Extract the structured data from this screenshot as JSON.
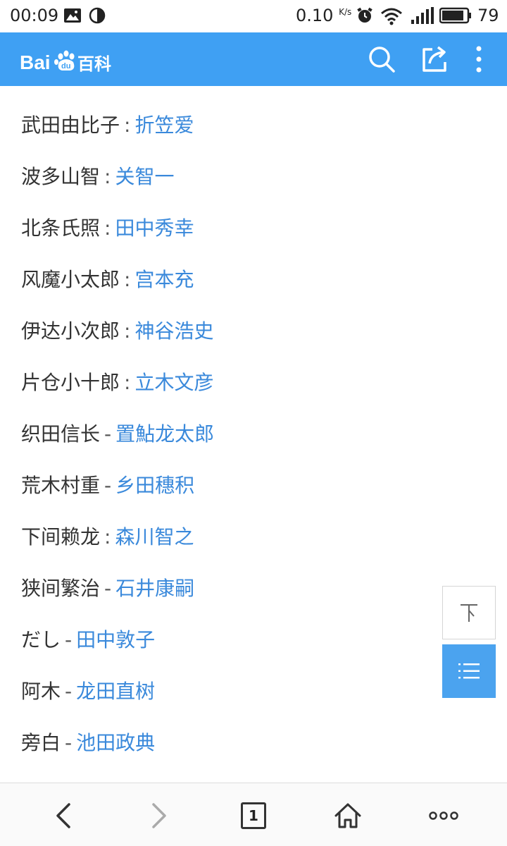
{
  "status_bar": {
    "time": "00:09",
    "net_speed": "0.10",
    "net_unit": "K/s",
    "battery": "79"
  },
  "app_bar": {
    "logo_text": "Bai",
    "logo_paw_text": "du",
    "logo_suffix": "百科"
  },
  "cast": [
    {
      "role": "武田由比子",
      "sep": ":",
      "actor": "折笠爱"
    },
    {
      "role": "波多山智",
      "sep": ":",
      "actor": "关智一"
    },
    {
      "role": "北条氏照",
      "sep": ":",
      "actor": "田中秀幸"
    },
    {
      "role": "风魔小太郎",
      "sep": ":",
      "actor": "宫本充"
    },
    {
      "role": "伊达小次郎",
      "sep": ":",
      "actor": "神谷浩史"
    },
    {
      "role": "片仓小十郎",
      "sep": ":",
      "actor": "立木文彦"
    },
    {
      "role": "织田信长",
      "sep": "-",
      "actor": "置鮎龙太郎"
    },
    {
      "role": "荒木村重",
      "sep": "-",
      "actor": "乡田穗积"
    },
    {
      "role": "下间赖龙",
      "sep": ":",
      "actor": "森川智之"
    },
    {
      "role": "狭间繁治",
      "sep": "-",
      "actor": "石井康嗣"
    },
    {
      "role": "だし",
      "sep": "-",
      "actor": "田中敦子"
    },
    {
      "role": "阿木",
      "sep": "-",
      "actor": "龙田直树"
    },
    {
      "role": "旁白",
      "sep": "-",
      "actor": "池田政典"
    }
  ],
  "bottom_bar": {
    "tab_count": "1"
  },
  "colors": {
    "brand_blue": "#3fa0f3",
    "link_blue": "#3a89db"
  }
}
